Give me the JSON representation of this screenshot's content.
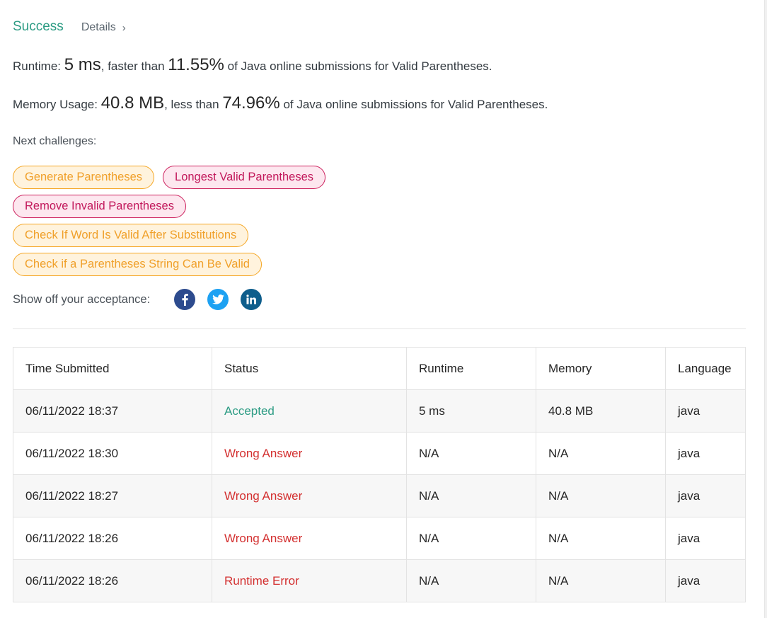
{
  "result": {
    "status": "Success",
    "details_label": "Details",
    "details_chevron": "›"
  },
  "runtime": {
    "label": "Runtime: ",
    "value": "5 ms",
    "mid": ", faster than ",
    "percent": "11.55%",
    "suffix": " of Java online submissions for Valid Parentheses."
  },
  "memory": {
    "label": "Memory Usage: ",
    "value": "40.8 MB",
    "mid": ", less than ",
    "percent": "74.96%",
    "suffix": " of Java online submissions for Valid Parentheses."
  },
  "next": {
    "label": "Next challenges:",
    "challenges": [
      {
        "title": "Generate Parentheses",
        "difficulty": "medium"
      },
      {
        "title": "Longest Valid Parentheses",
        "difficulty": "hard"
      },
      {
        "title": "Remove Invalid Parentheses",
        "difficulty": "hard"
      },
      {
        "title": "Check If Word Is Valid After Substitutions",
        "difficulty": "medium"
      },
      {
        "title": "Check if a Parentheses String Can Be Valid",
        "difficulty": "medium"
      }
    ]
  },
  "share": {
    "label": "Show off your acceptance:",
    "icons": [
      "facebook-icon",
      "twitter-icon",
      "linkedin-icon"
    ]
  },
  "colors": {
    "accepted": "#2d9c84",
    "error": "#d32f2f",
    "medium": "#f0a02a",
    "hard": "#c2185b"
  },
  "table": {
    "headers": [
      "Time Submitted",
      "Status",
      "Runtime",
      "Memory",
      "Language"
    ],
    "rows": [
      [
        "06/11/2022 18:37",
        "Accepted",
        "5 ms",
        "40.8 MB",
        "java"
      ],
      [
        "06/11/2022 18:30",
        "Wrong Answer",
        "N/A",
        "N/A",
        "java"
      ],
      [
        "06/11/2022 18:27",
        "Wrong Answer",
        "N/A",
        "N/A",
        "java"
      ],
      [
        "06/11/2022 18:26",
        "Wrong Answer",
        "N/A",
        "N/A",
        "java"
      ],
      [
        "06/11/2022 18:26",
        "Runtime Error",
        "N/A",
        "N/A",
        "java"
      ]
    ]
  }
}
